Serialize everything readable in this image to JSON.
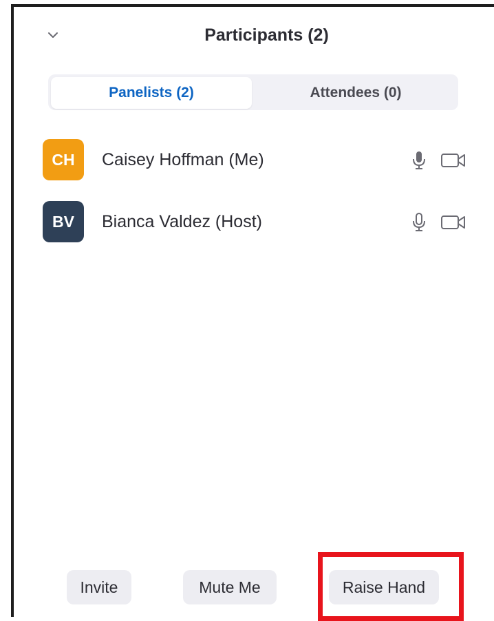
{
  "panel": {
    "title": "Participants (2)"
  },
  "tabs": [
    {
      "label": "Panelists (2)",
      "active": true
    },
    {
      "label": "Attendees (0)",
      "active": false
    }
  ],
  "participants": [
    {
      "initials": "CH",
      "name": "Caisey Hoffman (Me)",
      "avatar_color": "#f29d13",
      "mic_icon": "microphone-icon",
      "video_icon": "video-camera-icon"
    },
    {
      "initials": "BV",
      "name": "Bianca Valdez (Host)",
      "avatar_color": "#2e4057",
      "mic_icon": "microphone-icon",
      "video_icon": "video-camera-icon"
    }
  ],
  "actions": {
    "invite_label": "Invite",
    "mute_label": "Mute Me",
    "raise_hand_label": "Raise Hand"
  },
  "colors": {
    "accent": "#0e65c3",
    "highlight": "#e8141c"
  }
}
